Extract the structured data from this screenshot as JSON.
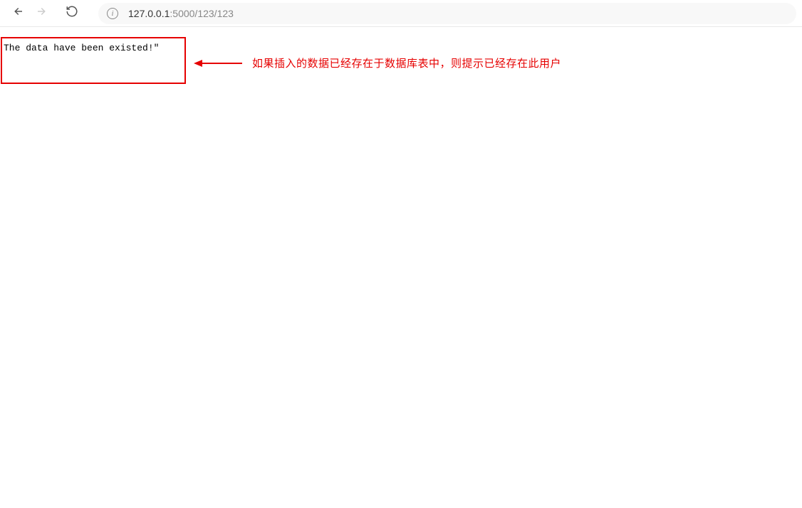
{
  "browser": {
    "url_host": "127.0.0.1",
    "url_path": ":5000/123/123"
  },
  "page": {
    "message": "The data have been existed!\""
  },
  "annotation": {
    "text": "如果插入的数据已经存在于数据库表中，则提示已经存在此用户"
  }
}
